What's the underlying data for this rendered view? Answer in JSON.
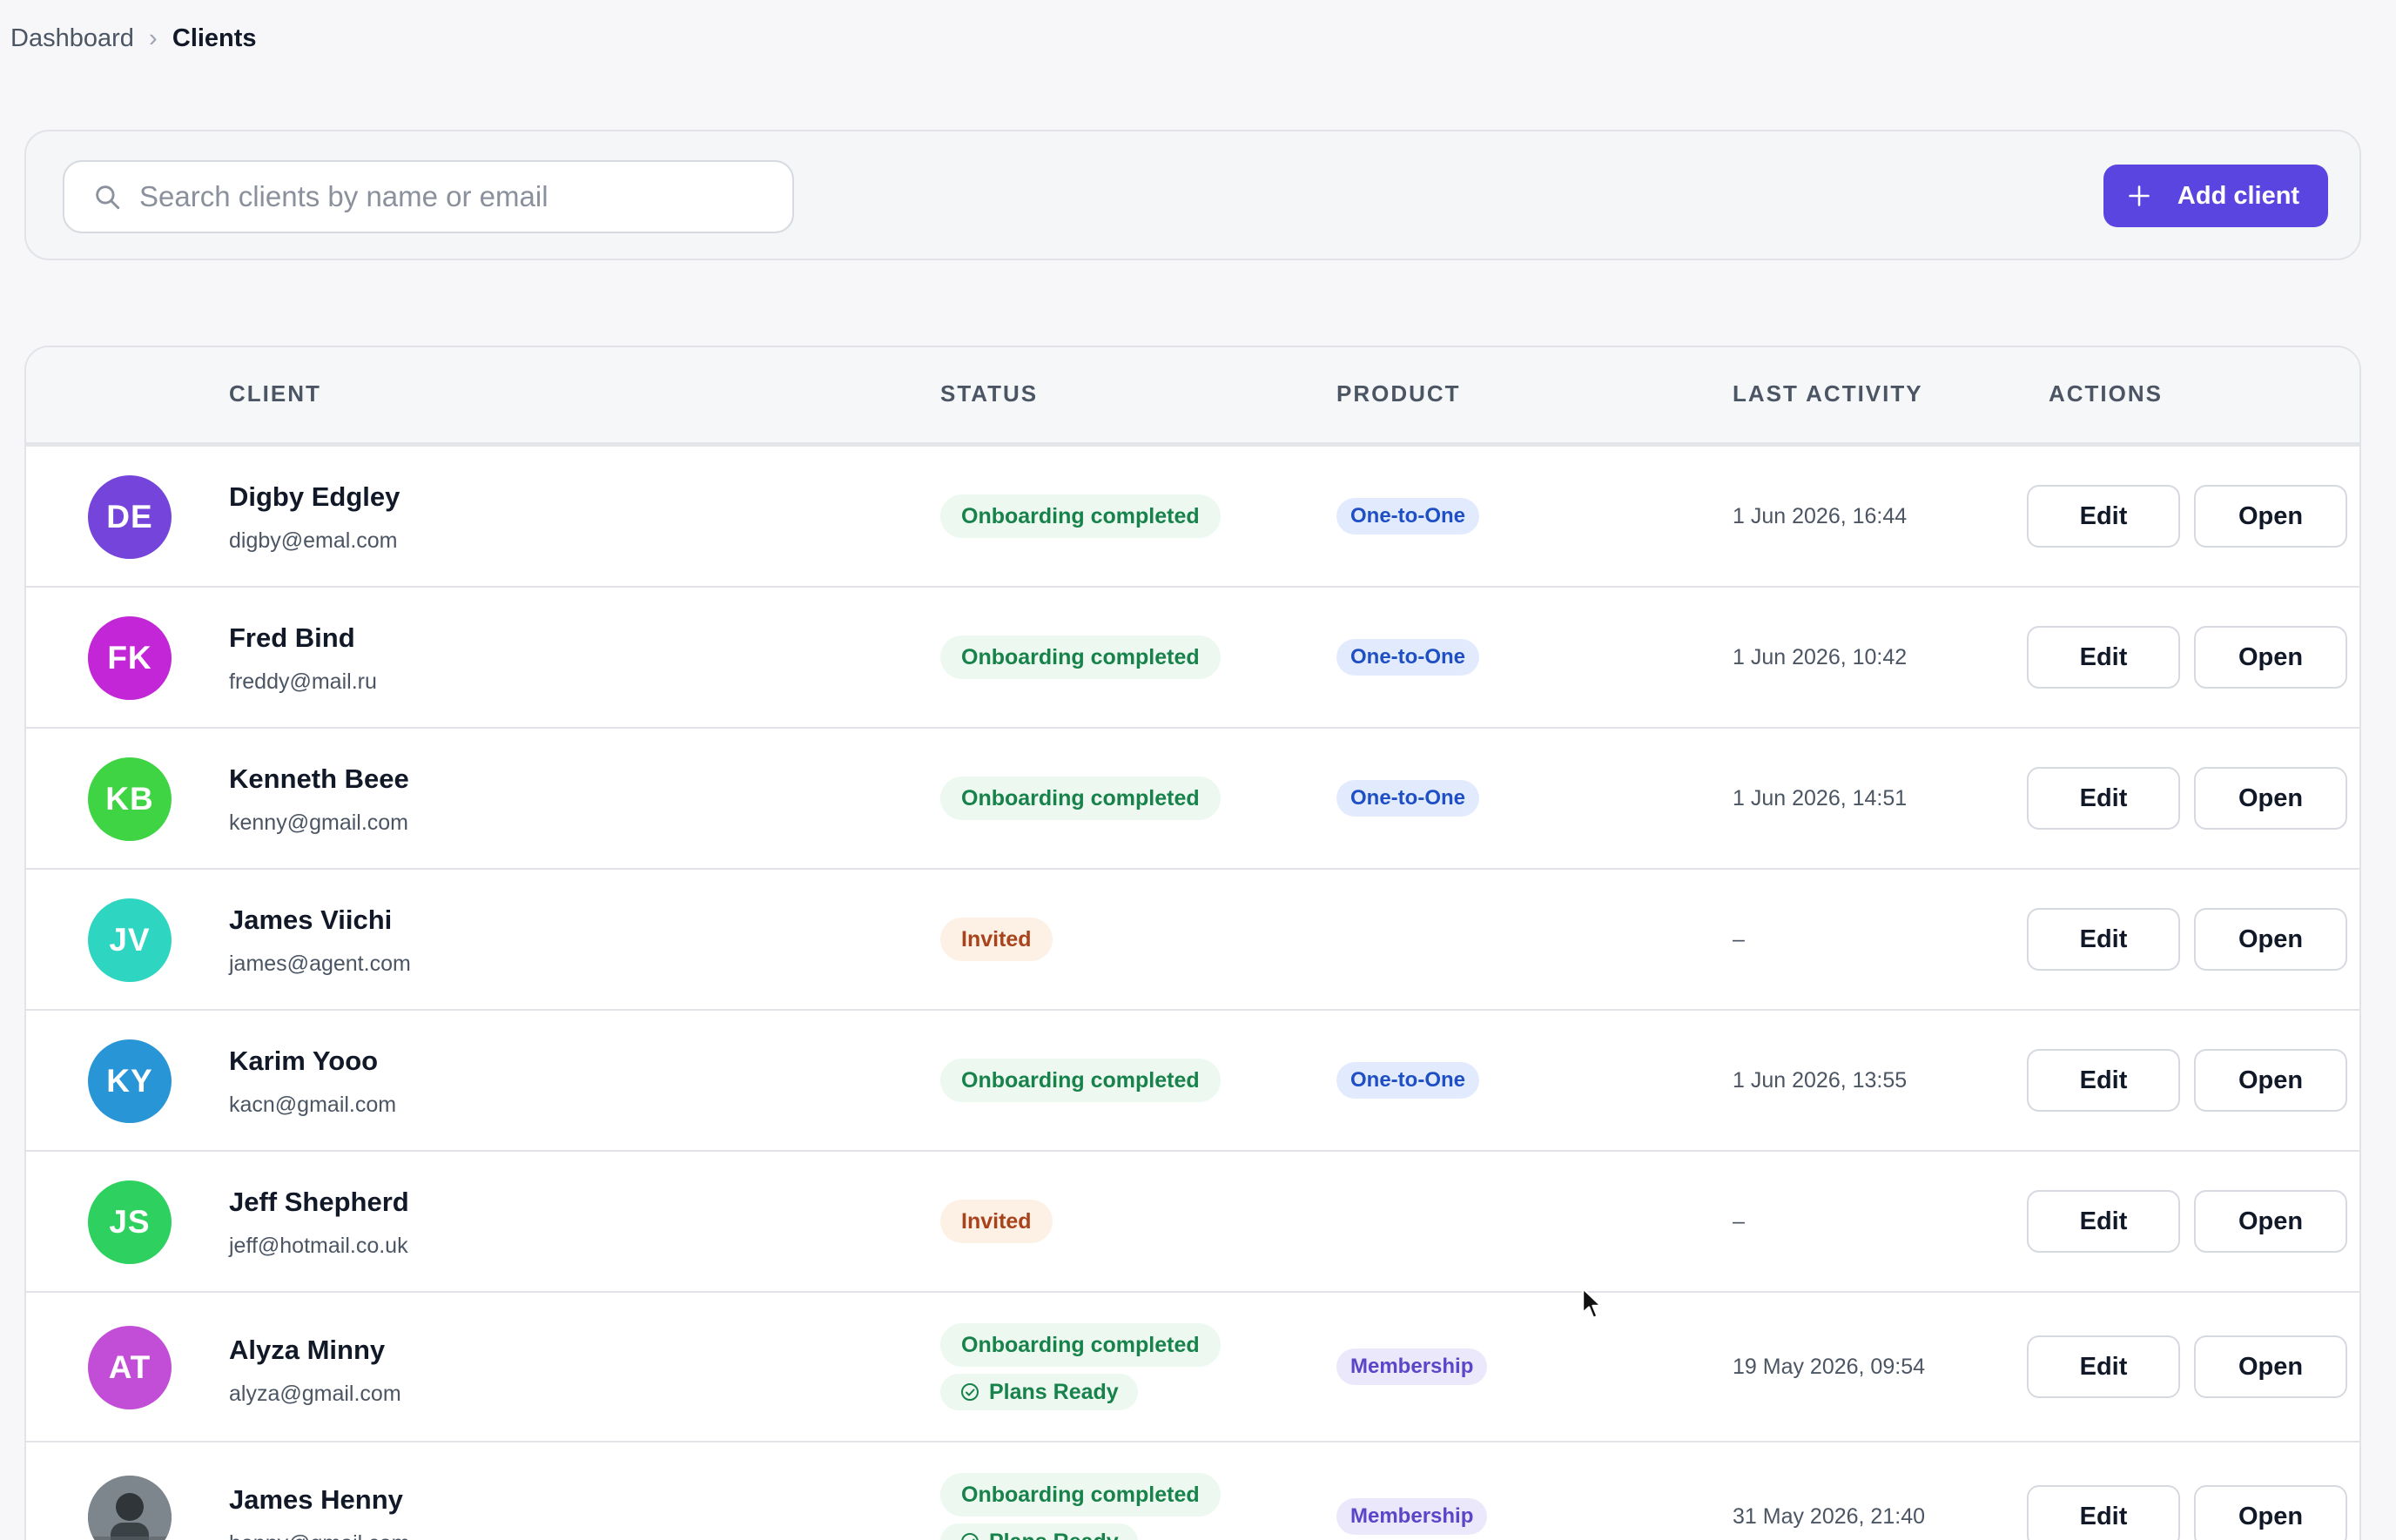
{
  "breadcrumb": {
    "parent": "Dashboard",
    "separator": "›",
    "current": "Clients"
  },
  "toolbar": {
    "search_placeholder": "Search clients by name or email",
    "search_icon": "search-icon",
    "add_label": "Add client",
    "add_icon": "plus-icon",
    "accent_color": "#5b45e0"
  },
  "table": {
    "headers": {
      "client": "CLIENT",
      "status": "STATUS",
      "product": "PRODUCT",
      "last_activity": "LAST ACTIVITY",
      "actions": "ACTIONS"
    },
    "edit_label": "Edit",
    "open_label": "Open",
    "rows": [
      {
        "initials": "DE",
        "avatar_color": "#7444db",
        "name": "Digby Edgley",
        "email": "digby@emal.com",
        "status": "Onboarding completed",
        "status_tone": "green",
        "extra_status": "",
        "product": "One-to-One",
        "product_tone": "blue",
        "last_activity": "1 Jun 2026, 16:44"
      },
      {
        "initials": "FK",
        "avatar_color": "#c226d6",
        "name": "Fred Bind",
        "email": "freddy@mail.ru",
        "status": "Onboarding completed",
        "status_tone": "green",
        "extra_status": "",
        "product": "One-to-One",
        "product_tone": "blue",
        "last_activity": "1 Jun 2026, 10:42"
      },
      {
        "initials": "KB",
        "avatar_color": "#3fd444",
        "name": "Kenneth Beee",
        "email": "kenny@gmail.com",
        "status": "Onboarding completed",
        "status_tone": "green",
        "extra_status": "",
        "product": "One-to-One",
        "product_tone": "blue",
        "last_activity": "1 Jun 2026, 14:51"
      },
      {
        "initials": "JV",
        "avatar_color": "#2ed5c0",
        "name": "James Viichi",
        "email": "james@agent.com",
        "status": "Invited",
        "status_tone": "orange",
        "extra_status": "",
        "product": "",
        "product_tone": "",
        "last_activity": "–"
      },
      {
        "initials": "KY",
        "avatar_color": "#2895d6",
        "name": "Karim Yooo",
        "email": "kacn@gmail.com",
        "status": "Onboarding completed",
        "status_tone": "green",
        "extra_status": "",
        "product": "One-to-One",
        "product_tone": "blue",
        "last_activity": "1 Jun 2026, 13:55"
      },
      {
        "initials": "JS",
        "avatar_color": "#2ed060",
        "name": "Jeff Shepherd",
        "email": "jeff@hotmail.co.uk",
        "status": "Invited",
        "status_tone": "orange",
        "extra_status": "",
        "product": "",
        "product_tone": "",
        "last_activity": "–"
      },
      {
        "initials": "AT",
        "avatar_color": "#c24ed8",
        "name": "Alyza Minny",
        "email": "alyza@gmail.com",
        "status": "Onboarding completed",
        "status_tone": "green",
        "extra_status": "Plans Ready",
        "product": "Membership",
        "product_tone": "purple",
        "last_activity": "19 May 2026, 09:54"
      },
      {
        "initials": "",
        "avatar_color": "#6b747a",
        "avatar_photo": true,
        "name": "James Henny",
        "email": "henny@gmail.com",
        "status": "Onboarding completed",
        "status_tone": "green",
        "extra_status": "Plans Ready",
        "product": "Membership",
        "product_tone": "purple",
        "last_activity": "31 May 2026, 21:40"
      }
    ]
  },
  "icons": {
    "check": "check-circle-icon",
    "cursor": "mouse-pointer-icon"
  }
}
